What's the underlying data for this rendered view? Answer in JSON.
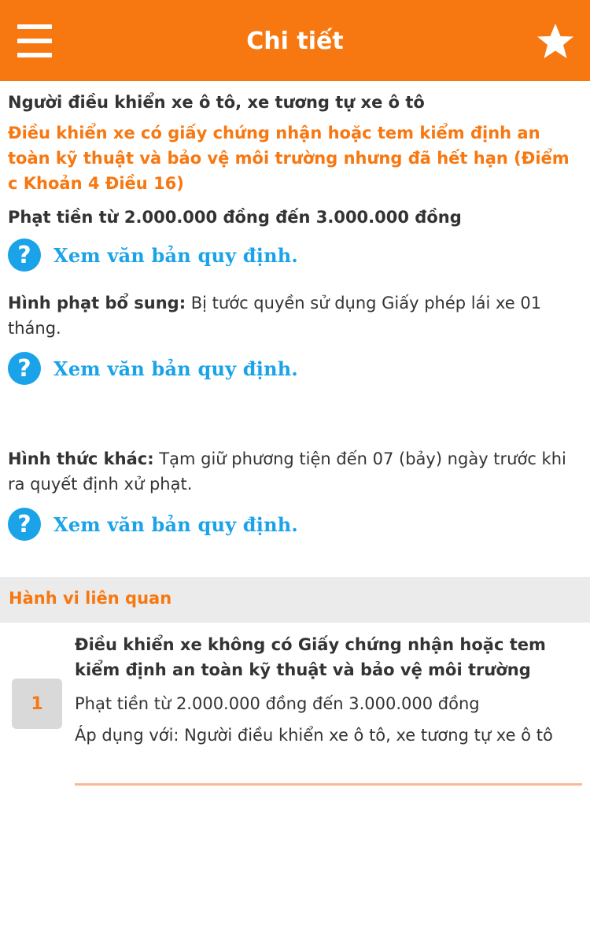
{
  "app": {
    "title": "Chi tiết",
    "menu_icon": "hamburger-menu-icon",
    "favorite_icon": "star-icon",
    "accent_color": "#f77811",
    "link_color": "#1aa3e8"
  },
  "detail": {
    "subject": "Người điều khiển xe ô tô, xe tương tự xe ô tô",
    "violation": "Điều khiển xe có giấy chứng nhận hoặc tem kiểm định an toàn kỹ thuật và bảo vệ môi trường nhưng đã hết hạn (Điểm c Khoản 4 Điều 16)",
    "fine": "Phạt tiền từ 2.000.000 đồng đến 3.000.000 đồng",
    "law_link_label": "Xem văn bản quy định.",
    "help_icon": "question-circle-icon",
    "supplementary_label": "Hình phạt bổ sung:",
    "supplementary_text": " Bị tước quyền sử dụng Giấy phép lái xe 01 tháng.",
    "other_label": "Hình thức khác:",
    "other_text": " Tạm giữ phương tiện đến 07 (bảy) ngày trước khi ra quyết định xử phạt."
  },
  "related": {
    "header": "Hành vi liên quan",
    "items": [
      {
        "index": "1",
        "title": "Điều khiển xe không có Giấy chứng nhận hoặc tem kiểm định an toàn kỹ thuật và bảo vệ môi trường",
        "fine": "Phạt tiền từ 2.000.000 đồng đến 3.000.000 đồng",
        "applies_to": "Áp dụng với: Người điều khiển xe ô tô, xe tương tự xe ô tô"
      }
    ]
  }
}
